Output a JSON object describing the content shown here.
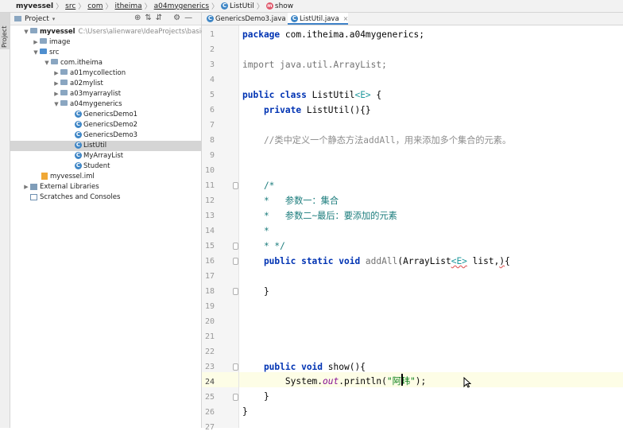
{
  "breadcrumb": {
    "items": [
      "myvessel",
      "src",
      "com",
      "itheima",
      "a04mygenerics",
      "ListUtil",
      "show"
    ]
  },
  "toolstrip": {
    "project_label": "Project"
  },
  "project_panel": {
    "title": "Project",
    "tree": [
      {
        "label": "myvessel",
        "path": "C:\\Users\\alienware\\IdeaProjects\\basic-cod"
      },
      {
        "label": "image"
      },
      {
        "label": "src"
      },
      {
        "label": "com.itheima"
      },
      {
        "label": "a01mycollection"
      },
      {
        "label": "a02mylist"
      },
      {
        "label": "a03myarraylist"
      },
      {
        "label": "a04mygenerics"
      },
      {
        "label": "GenericsDemo1"
      },
      {
        "label": "GenericsDemo2"
      },
      {
        "label": "GenericsDemo3"
      },
      {
        "label": "ListUtil"
      },
      {
        "label": "MyArrayList"
      },
      {
        "label": "Student"
      },
      {
        "label": "myvessel.iml"
      },
      {
        "label": "External Libraries"
      },
      {
        "label": "Scratches and Consoles"
      }
    ]
  },
  "editor": {
    "tabs": [
      {
        "label": "GenericsDemo3.java",
        "active": false
      },
      {
        "label": "ListUtil.java",
        "active": true
      }
    ],
    "line_numbers": [
      "1",
      "2",
      "3",
      "4",
      "5",
      "6",
      "7",
      "8",
      "9",
      "10",
      "11",
      "12",
      "13",
      "14",
      "15",
      "16",
      "17",
      "18",
      "19",
      "20",
      "21",
      "22",
      "23",
      "24",
      "25",
      "26",
      "27"
    ],
    "current_line": 24,
    "code": {
      "l1_kw": "package",
      "l1_rest": " com.itheima.a04mygenerics;",
      "l3_kw": "import",
      "l3_rest": " java.util.ArrayList;",
      "l5_kw": "public class",
      "l5_name": " ListUtil",
      "l5_gen": "<E>",
      "l5_rest": " {",
      "l6_kw": "    private",
      "l6_rest": " ListUtil(){}",
      "l8_comment_a": "    //类中定义一个静态方法",
      "l8_comment_b": "addAll",
      "l8_comment_c": "，用来添加多个集合的元素。",
      "l11": "    /*",
      "l12": "    *   参数一：集合",
      "l13": "    *   参数二~最后：要添加的元素",
      "l14": "    *",
      "l15": "    * */",
      "l16_kw": "    public static void",
      "l16_name": " addAll",
      "l16_a": "(ArrayList",
      "l16_gen": "<E>",
      "l16_b": " list,",
      "l16_c": ")",
      "l16_d": "{",
      "l18": "    }",
      "l23_kw": "    public void",
      "l23_rest": " show(){",
      "l24_a": "        System.",
      "l24_field": "out",
      "l24_b": ".println(",
      "l24_str": "\"阿玮\"",
      "l24_c": ");",
      "l25": "    }",
      "l26": "}"
    }
  },
  "colors": {
    "keyword": "#0033b3",
    "string": "#067d17",
    "comment": "#8c8c8c",
    "doc_comment": "#197b7b",
    "generic": "#20999d",
    "field": "#871094",
    "selection": "#d5d5d5",
    "current_line": "#fdfde6"
  }
}
